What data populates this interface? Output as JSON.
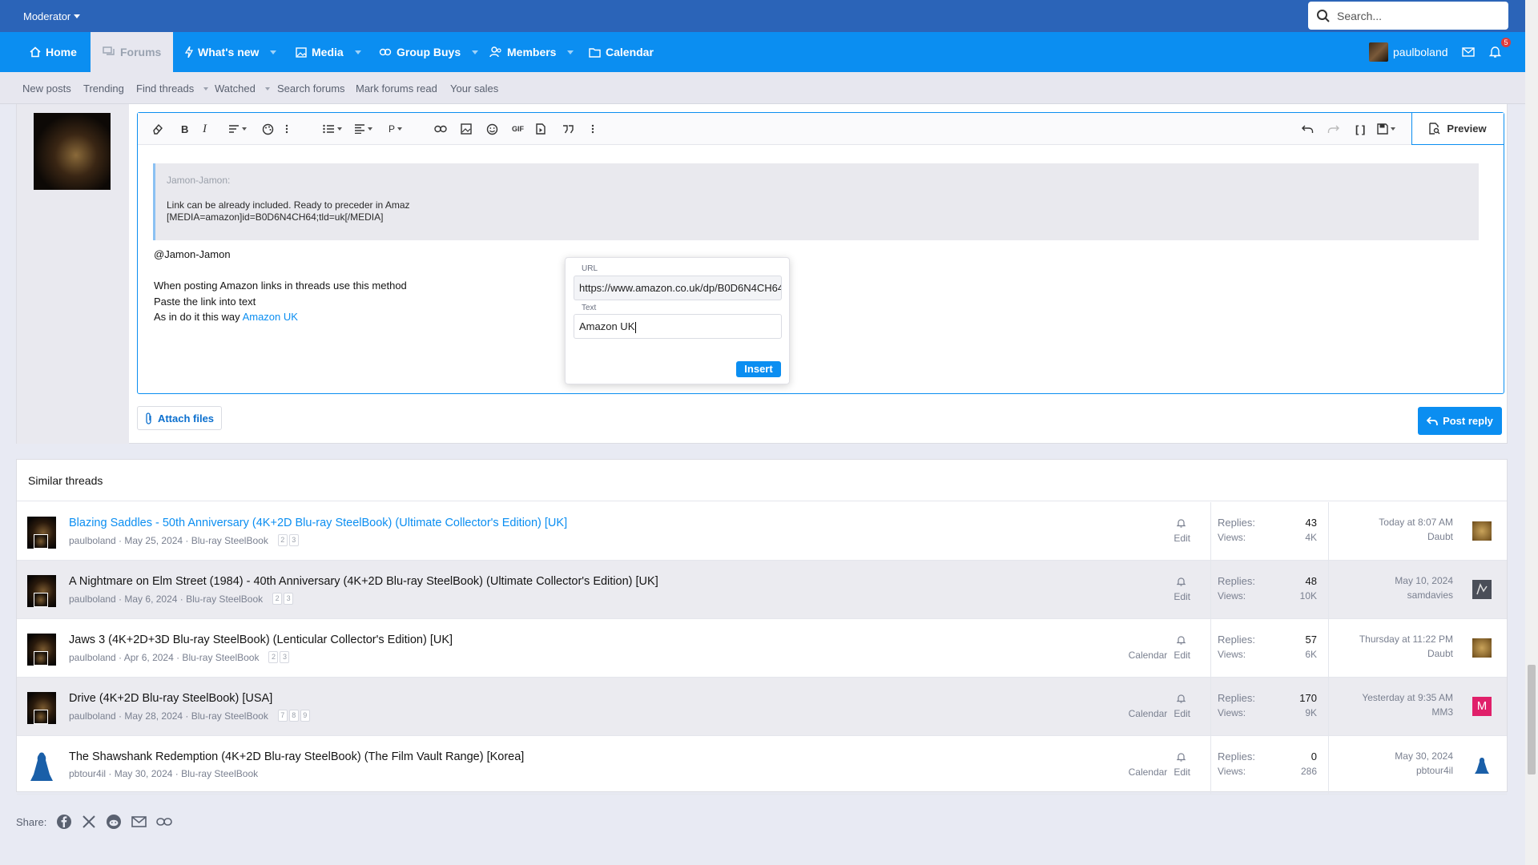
{
  "topbar": {
    "moderator_label": "Moderator",
    "search_placeholder": "Search..."
  },
  "nav": {
    "home": "Home",
    "forums": "Forums",
    "whats_new": "What's new",
    "media": "Media",
    "group_buys": "Group Buys",
    "members": "Members",
    "calendar": "Calendar",
    "username": "paulboland",
    "alerts_count": "5"
  },
  "subnav": [
    "New posts",
    "Trending",
    "Find threads",
    "Watched",
    "Search forums",
    "Mark forums read",
    "Your sales"
  ],
  "editor": {
    "preview_label": "Preview",
    "quote_author": "Jamon-Jamon:",
    "quote_line1": "Link can be already included. Ready to preceder in Amaz",
    "quote_line2": "[MEDIA=amazon]id=B0D6N4CH64;tld=uk[/MEDIA]",
    "mention": "@Jamon-Jamon",
    "line1": "When posting Amazon links in threads use this method",
    "line2": "Paste the link into text",
    "line3_prefix": "As in do it this way ",
    "line3_link": "Amazon UK"
  },
  "link_popup": {
    "url_label": "URL",
    "url_value": "https://www.amazon.co.uk/dp/B0D6N4CH64",
    "text_label": "Text",
    "text_value": "Amazon UK",
    "insert_label": "Insert"
  },
  "actions": {
    "attach_label": "Attach files",
    "post_reply_label": "Post reply"
  },
  "similar": {
    "heading": "Similar threads",
    "replies_label": "Replies:",
    "views_label": "Views:",
    "calendar_label": "Calendar",
    "edit_label": "Edit",
    "threads": [
      {
        "title": "Blazing Saddles - 50th Anniversary (4K+2D Blu-ray SteelBook) (Ultimate Collector's Edition) [UK]",
        "meta": "paulboland · May 25, 2024 · Blu-ray SteelBook",
        "pages": [
          "2",
          "3"
        ],
        "replies": "43",
        "views": "4K",
        "last_date": "Today at 8:07 AM",
        "last_user": "Daubt"
      },
      {
        "title": "A Nightmare on Elm Street (1984) - 40th Anniversary (4K+2D Blu-ray SteelBook) (Ultimate Collector's Edition) [UK]",
        "meta": "paulboland · May 6, 2024 · Blu-ray SteelBook",
        "pages": [
          "2",
          "3"
        ],
        "replies": "48",
        "views": "10K",
        "last_date": "May 10, 2024",
        "last_user": "samdavies"
      },
      {
        "title": "Jaws 3 (4K+2D+3D Blu-ray SteelBook) (Lenticular Collector's Edition) [UK]",
        "meta": "paulboland · Apr 6, 2024 · Blu-ray SteelBook",
        "pages": [
          "2",
          "3"
        ],
        "replies": "57",
        "views": "6K",
        "last_date": "Thursday at 11:22 PM",
        "last_user": "Daubt"
      },
      {
        "title": "Drive (4K+2D Blu-ray SteelBook) [USA]",
        "meta": "paulboland · May 28, 2024 · Blu-ray SteelBook",
        "pages": [
          "7",
          "8",
          "9"
        ],
        "replies": "170",
        "views": "9K",
        "last_date": "Yesterday at 9:35 AM",
        "last_user": "MM3",
        "last_avatar_letter": "M"
      },
      {
        "title": "The Shawshank Redemption (4K+2D Blu-ray SteelBook) (The Film Vault Range) [Korea]",
        "meta": "pbtour4il · May 30, 2024 · Blu-ray SteelBook",
        "pages": [],
        "replies": "0",
        "views": "286",
        "last_date": "May 30, 2024",
        "last_user": "pbtour4il"
      }
    ]
  },
  "share": {
    "label": "Share:"
  },
  "colors": {
    "topbar": "#2b64b8",
    "nav": "#0b8ef1",
    "accent": "#0b8ef1"
  }
}
